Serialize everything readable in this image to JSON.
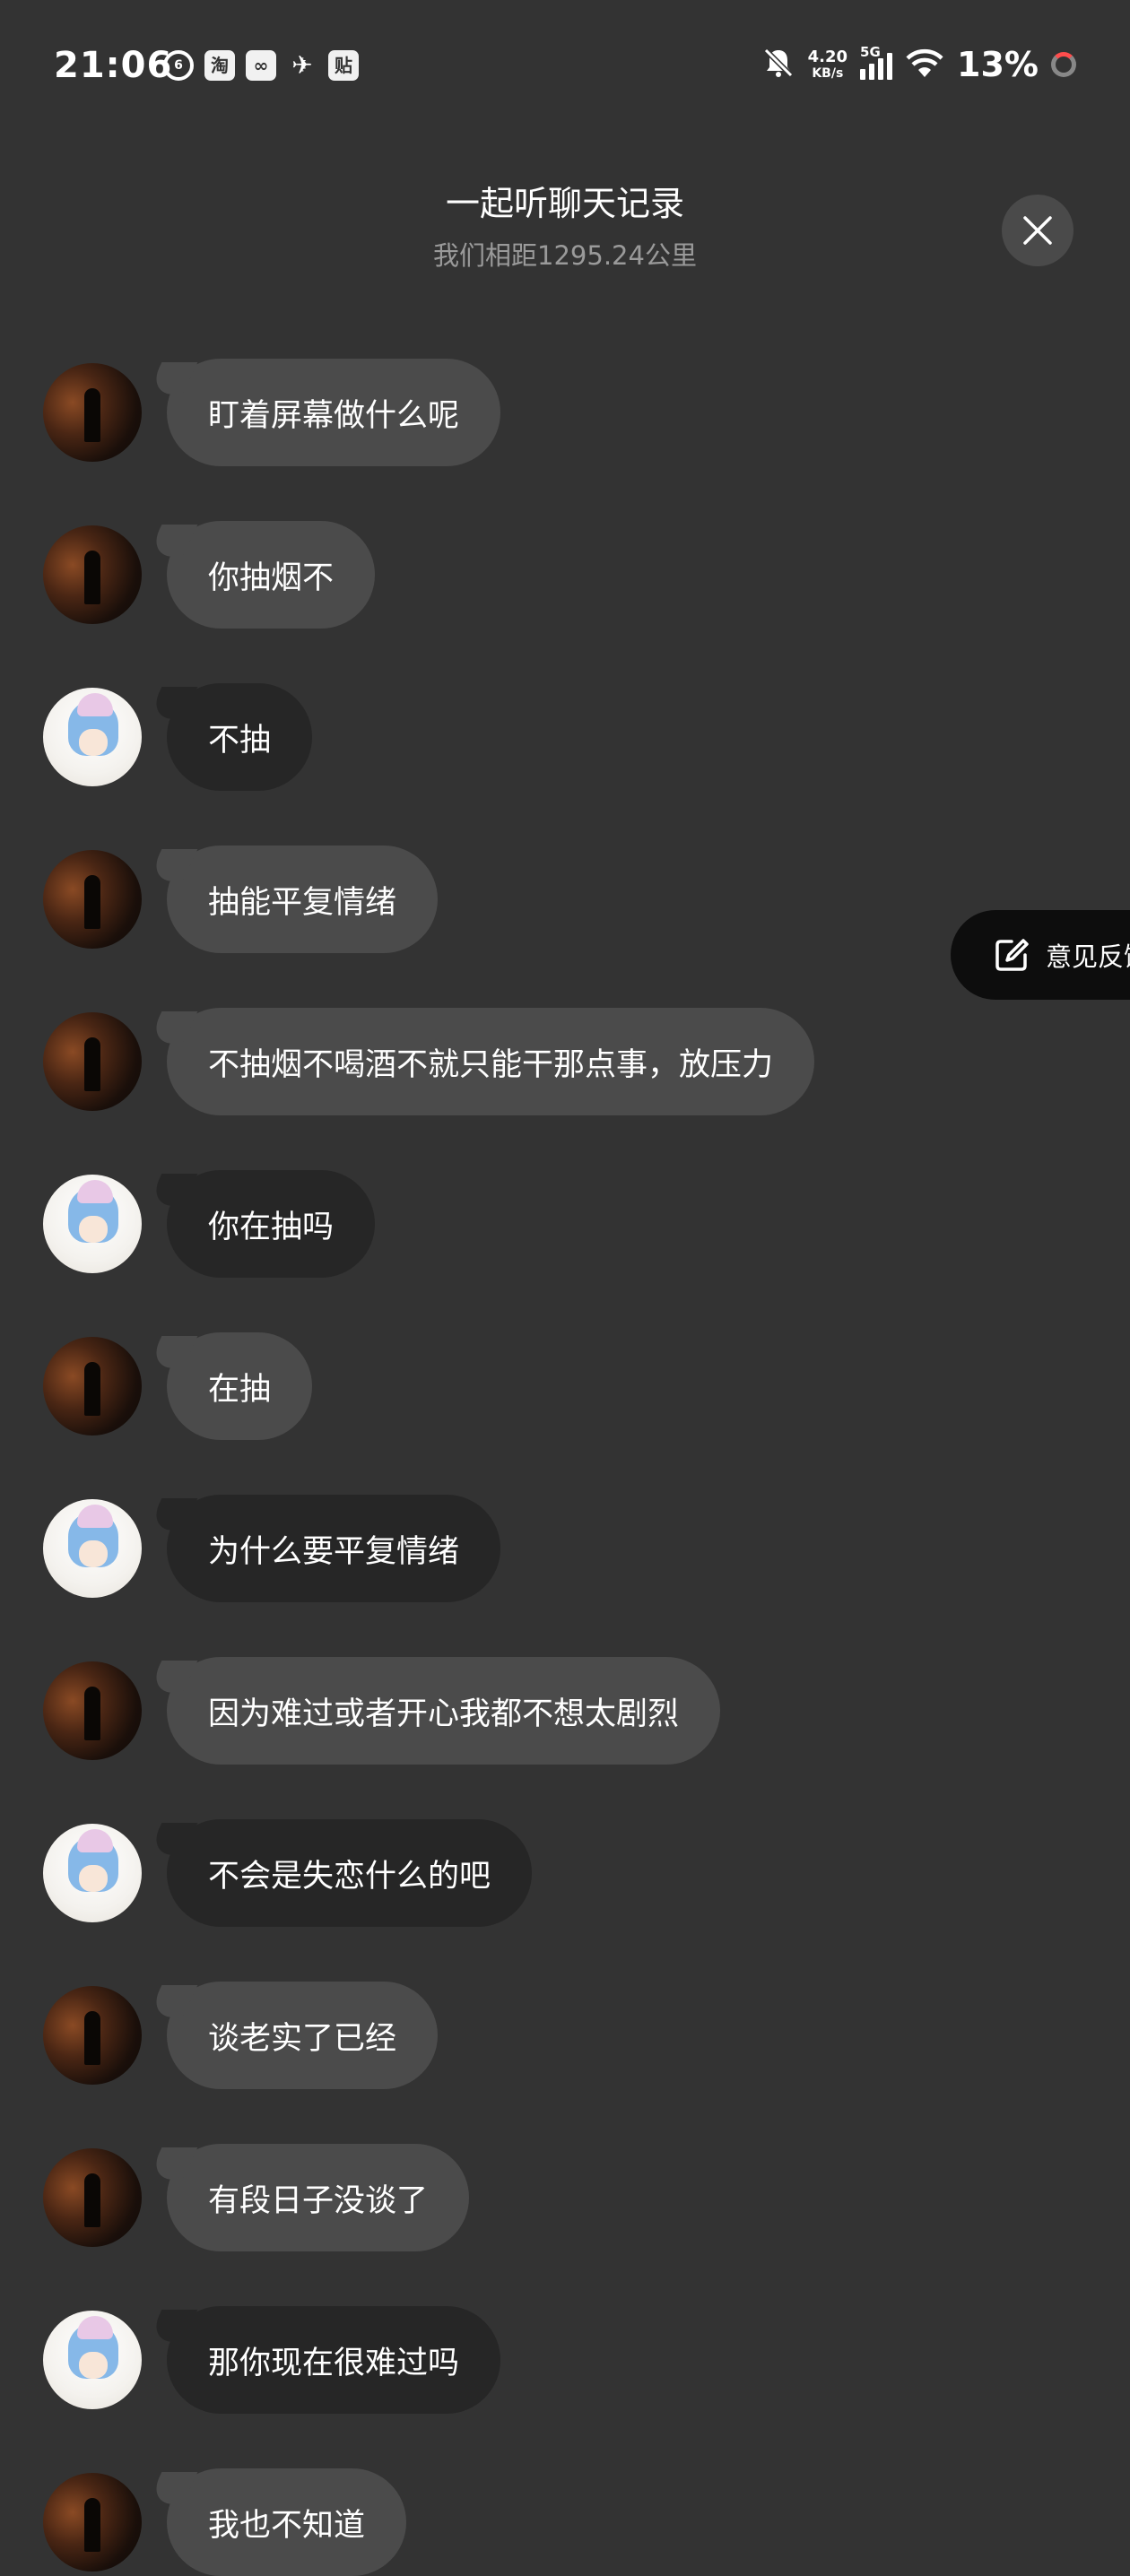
{
  "status_bar": {
    "time": "21:06",
    "net_speed": "4.20",
    "net_speed_unit": "KB/s",
    "network_type": "5G",
    "battery_percent": "13%",
    "left_icons": [
      "netease-music-icon",
      "taobao-icon",
      "app-icon",
      "bird-icon",
      "tieba-icon"
    ],
    "left_icon_labels": [
      "6",
      "淘",
      "∞",
      "✈",
      "贴"
    ]
  },
  "header": {
    "title": "一起听聊天记录",
    "subtitle": "我们相距1295.24公里"
  },
  "feedback": {
    "label": "意见反馈"
  },
  "colors": {
    "background": "#333333",
    "bubble_other": "#4b4b4b",
    "bubble_me": "#262626",
    "feedback_bg": "#0d0d0d"
  },
  "messages": [
    {
      "sender": "other",
      "text": "盯着屏幕做什么呢"
    },
    {
      "sender": "other",
      "text": "你抽烟不"
    },
    {
      "sender": "me",
      "text": "不抽"
    },
    {
      "sender": "other",
      "text": "抽能平复情绪"
    },
    {
      "sender": "other",
      "text": "不抽烟不喝酒不就只能干那点事，放压力"
    },
    {
      "sender": "me",
      "text": "你在抽吗"
    },
    {
      "sender": "other",
      "text": "在抽"
    },
    {
      "sender": "me",
      "text": "为什么要平复情绪"
    },
    {
      "sender": "other",
      "text": "因为难过或者开心我都不想太剧烈"
    },
    {
      "sender": "me",
      "text": "不会是失恋什么的吧"
    },
    {
      "sender": "other",
      "text": "谈老实了已经"
    },
    {
      "sender": "other",
      "text": "有段日子没谈了"
    },
    {
      "sender": "me",
      "text": "那你现在很难过吗"
    },
    {
      "sender": "other",
      "text": "我也不知道"
    }
  ]
}
